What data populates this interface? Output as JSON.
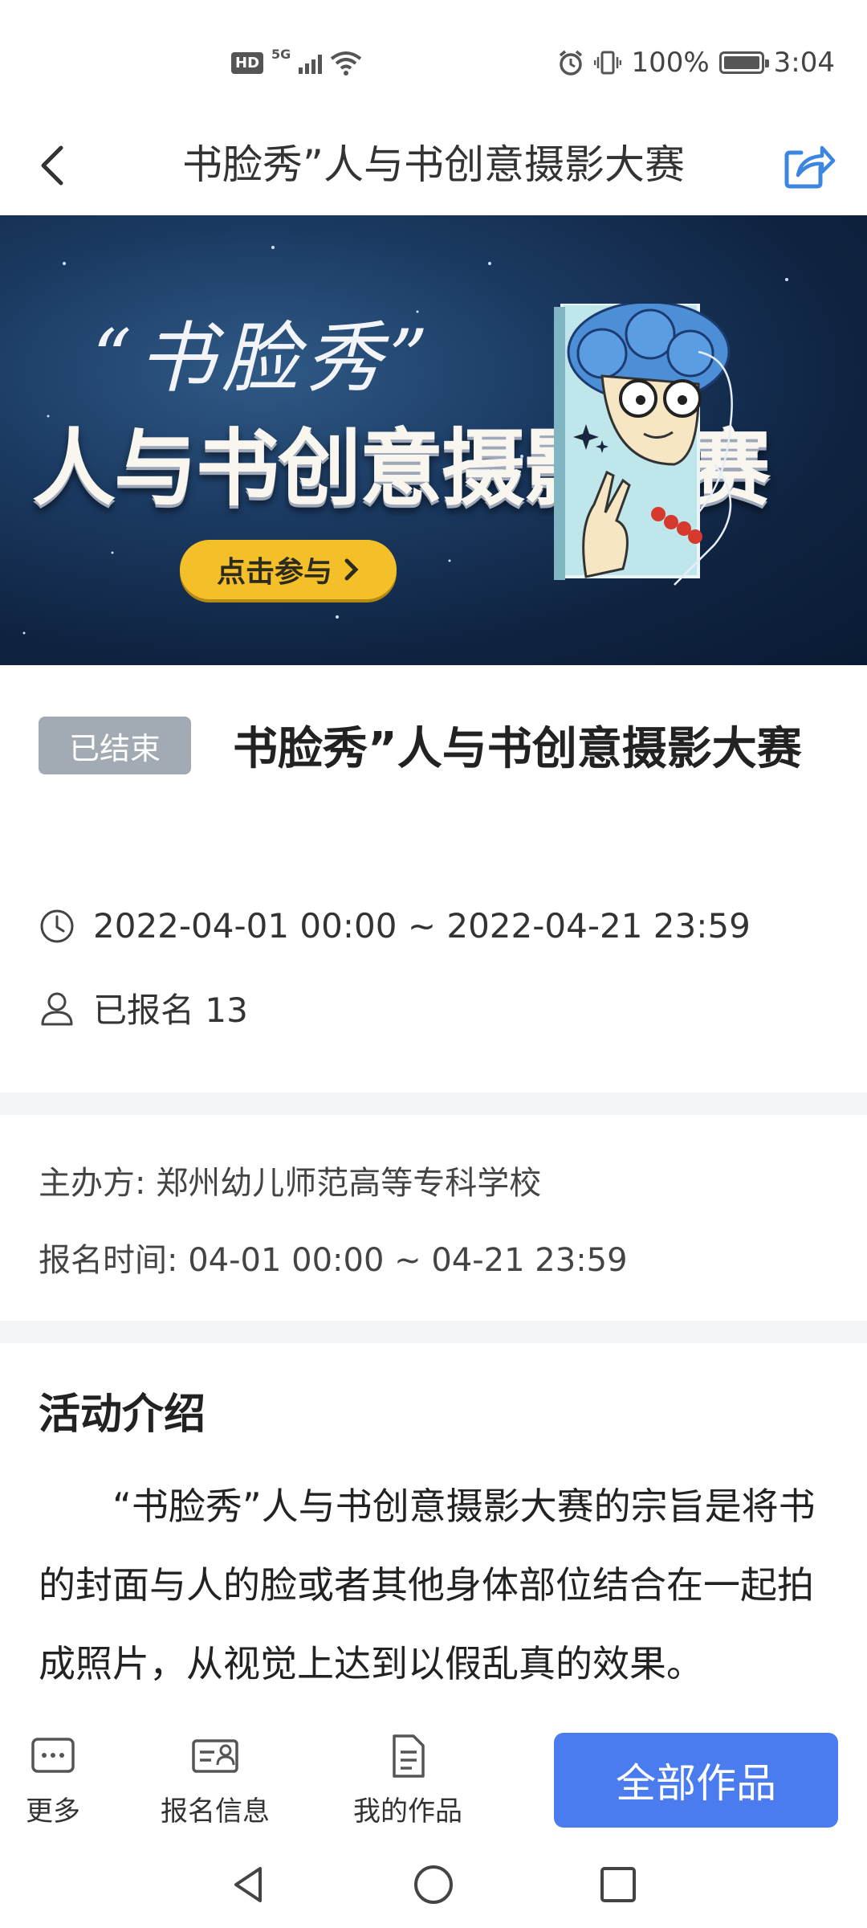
{
  "status_bar": {
    "hd": "HD",
    "signal_label": "5G",
    "battery": "100%",
    "time": "3:04"
  },
  "header": {
    "title": "书脸秀”人与书创意摄影大赛"
  },
  "banner": {
    "script_text": "“书脸秀”",
    "title": "人与书创意摄影大赛",
    "button_label": "点击参与"
  },
  "event": {
    "status": "已结束",
    "title": "书脸秀”人与书创意摄影大赛",
    "time_range": "2022-04-01 00:00 ~ 2022-04-21 23:59",
    "registered": "已报名 13"
  },
  "details": {
    "organizer": "主办方: 郑州幼儿师范高等专科学校",
    "signup_time": "报名时间: 04-01 00:00 ~ 04-21 23:59"
  },
  "intro": {
    "heading": "活动介绍",
    "body": "“书脸秀”人与书创意摄影大赛的宗旨是将书的封面与人的脸或者其他身体部位结合在一起拍成照片，从视觉上达到以假乱真的效果。"
  },
  "bottom_bar": {
    "more": "更多",
    "signup_info": "报名信息",
    "my_works": "我的作品",
    "all_works": "全部作品"
  },
  "colors": {
    "primary": "#4a7cf0",
    "tag_gray": "#a2aab3",
    "banner_bg": "#1b3a62",
    "banner_button": "#f4c02a"
  }
}
